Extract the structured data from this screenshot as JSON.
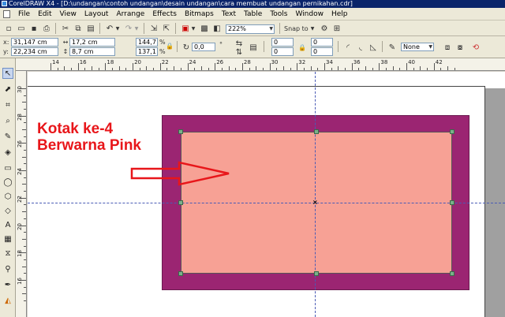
{
  "window": {
    "title": "CorelDRAW X4 - [D:\\undangan\\contoh undangan\\desain undangan\\cara membuat undangan pernikahan.cdr]"
  },
  "menu": [
    "File",
    "Edit",
    "View",
    "Layout",
    "Arrange",
    "Effects",
    "Bitmaps",
    "Text",
    "Table",
    "Tools",
    "Window",
    "Help"
  ],
  "toolbar": {
    "zoom_value": "222%",
    "snap_to_label": "Snap to"
  },
  "property_bar": {
    "x_label": "x:",
    "x_value": "31,147 cm",
    "y_label": "y:",
    "y_value": "22,234 cm",
    "width_value": "17,2 cm",
    "height_value": "8,7 cm",
    "scale_x": "144,7",
    "scale_y": "137,1",
    "percent_symbol": "%",
    "rotation_value": "0,0",
    "degree_symbol": "°",
    "corner_values": [
      "0",
      "0",
      "0",
      "0"
    ],
    "outline_value": "None"
  },
  "rulers": {
    "horizontal_labels": [
      "14",
      "16",
      "18",
      "20",
      "22",
      "24",
      "26",
      "28",
      "30",
      "32",
      "34",
      "36",
      "38",
      "40",
      "42"
    ],
    "vertical_labels": [
      "30",
      "28",
      "26",
      "24",
      "22",
      "20",
      "18",
      "16"
    ]
  },
  "canvas": {
    "annotation_line1": "Kotak ke-4",
    "annotation_line2": "Berwarna Pink",
    "center_marker": "×",
    "colors": {
      "outer_rectangle": "#9b2572",
      "inner_rectangle": "#f7a195",
      "annotation_text": "#e8161a",
      "guide_line": "#4a5bb5"
    }
  },
  "icons": {
    "toolbox": [
      "pick-tool-icon",
      "shape-tool-icon",
      "crop-tool-icon",
      "zoom-tool-icon",
      "freehand-tool-icon",
      "smart-fill-icon",
      "rectangle-tool-icon",
      "ellipse-tool-icon",
      "polygon-tool-icon",
      "basic-shapes-icon",
      "text-tool-icon",
      "table-tool-icon",
      "interactive-blend-icon",
      "eyedropper-icon",
      "outline-pen-icon",
      "fill-tool-icon"
    ]
  }
}
